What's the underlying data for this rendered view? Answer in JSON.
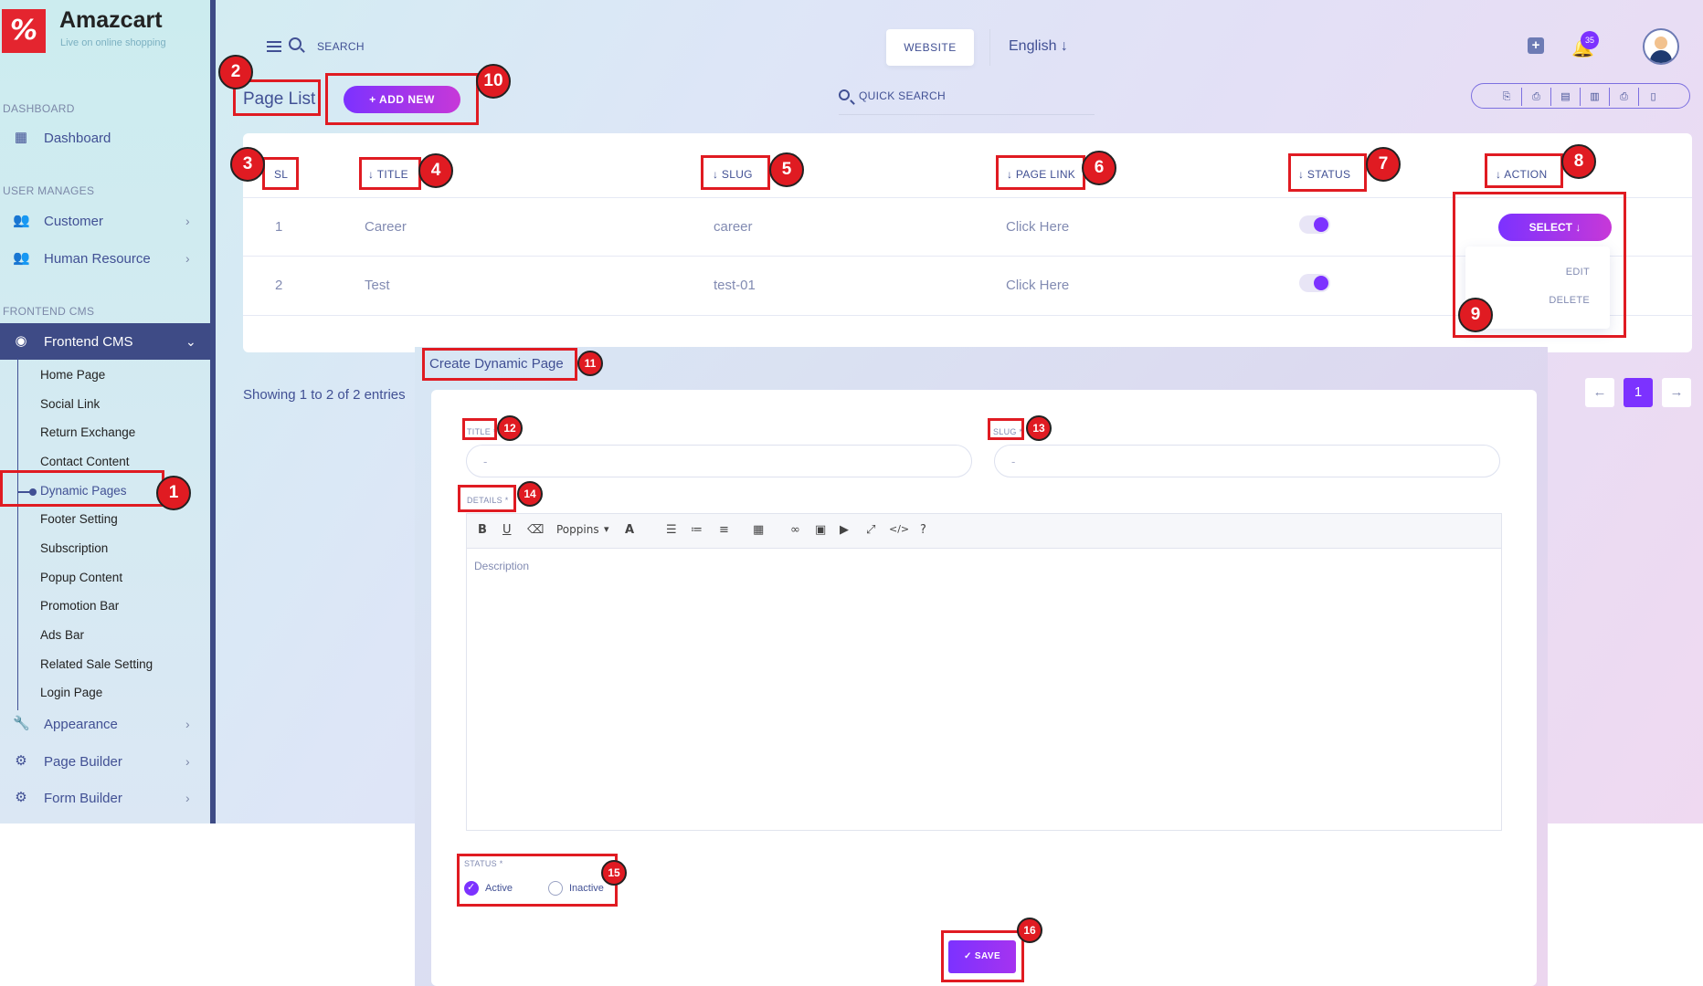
{
  "sidebar": {
    "logo_mark": "%",
    "brand": "Amazcart",
    "tagline": "Live on online shopping",
    "sections": {
      "dashboard": "DASHBOARD",
      "user_manages": "USER MANAGES",
      "frontend_cms": "FRONTEND CMS"
    },
    "items": {
      "dashboard": "Dashboard",
      "customer": "Customer",
      "human_resource": "Human Resource",
      "frontend_cms": "Frontend CMS",
      "appearance": "Appearance",
      "page_builder": "Page Builder",
      "form_builder": "Form Builder"
    },
    "sub_items": [
      "Home Page",
      "Social Link",
      "Return Exchange",
      "Contact Content",
      "Dynamic Pages",
      "Footer Setting",
      "Subscription",
      "Popup Content",
      "Promotion Bar",
      "Ads Bar",
      "Related Sale Setting",
      "Login Page"
    ]
  },
  "header": {
    "search_label": "SEARCH",
    "website_button": "WEBSITE",
    "language": "English ↓",
    "notification_count": "35"
  },
  "page": {
    "title": "Page List",
    "add_new": "+ ADD NEW",
    "quick_search": "QUICK SEARCH",
    "export_icons": [
      "⎘",
      "⎙",
      "▤",
      "▥",
      "⎙",
      "▯"
    ]
  },
  "table": {
    "headers": {
      "sl": "SL",
      "title": "↓ TITLE",
      "slug": "↓ SLUG",
      "page_link": "↓ PAGE LINK",
      "status": "↓ STATUS",
      "action": "↓ ACTION"
    },
    "rows": [
      {
        "sl": "1",
        "title": "Career",
        "slug": "career",
        "link": "Click Here",
        "status": true
      },
      {
        "sl": "2",
        "title": "Test",
        "slug": "test-01",
        "link": "Click Here",
        "status": true
      }
    ],
    "select_label": "SELECT ↓",
    "menu": {
      "edit": "EDIT",
      "delete": "DELETE"
    },
    "showing": "Showing 1 to 2 of 2 entries",
    "pagination": {
      "prev": "←",
      "current": "1",
      "next": "→"
    }
  },
  "modal": {
    "title": "Create Dynamic Page",
    "title_label": "TITLE *",
    "title_placeholder": "-",
    "slug_label": "SLUG *",
    "slug_placeholder": "-",
    "details_label": "DETAILS *",
    "font_select": "Poppins",
    "editor_placeholder": "Description",
    "status_label": "STATUS *",
    "status_options": {
      "active": "Active",
      "inactive": "Inactive"
    },
    "status_value": "Active",
    "save": "✓ SAVE"
  },
  "annotations": [
    "1",
    "2",
    "3",
    "4",
    "5",
    "6",
    "7",
    "8",
    "9",
    "10",
    "11",
    "12",
    "13",
    "14",
    "15",
    "16"
  ],
  "colors": {
    "primary": "#7c32ff",
    "accent": "#c738d8",
    "sidebar_active": "#3e4b86",
    "text": "#415094",
    "highlight": "#e01b22"
  }
}
